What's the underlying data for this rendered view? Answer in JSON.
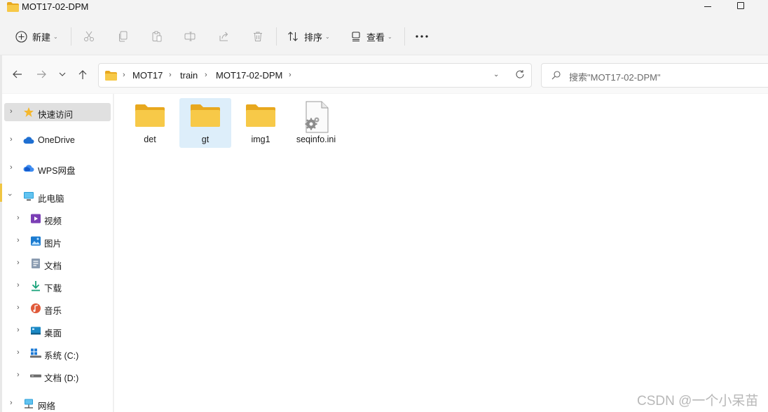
{
  "window": {
    "title": "MOT17-02-DPM"
  },
  "toolbar": {
    "new_label": "新建",
    "cut_label": "",
    "sort_label": "排序",
    "view_label": "查看",
    "more_label": "···"
  },
  "address": {
    "crumbs": [
      "MOT17",
      "train",
      "MOT17-02-DPM"
    ],
    "search_placeholder": "搜索\"MOT17-02-DPM\""
  },
  "sidebar": {
    "items": [
      {
        "label": "快速访问",
        "icon": "star-icon",
        "selected": true
      },
      {
        "label": "OneDrive",
        "icon": "cloud-icon"
      },
      {
        "label": "WPS网盘",
        "icon": "wps-cloud-icon"
      },
      {
        "label": "此电脑",
        "icon": "computer-icon",
        "expanded": true
      },
      {
        "label": "视频",
        "icon": "video-icon"
      },
      {
        "label": "图片",
        "icon": "pictures-icon"
      },
      {
        "label": "文档",
        "icon": "documents-icon"
      },
      {
        "label": "下载",
        "icon": "download-icon"
      },
      {
        "label": "音乐",
        "icon": "music-icon"
      },
      {
        "label": "桌面",
        "icon": "desktop-icon"
      },
      {
        "label": "系统 (C:)",
        "icon": "drive-c-icon"
      },
      {
        "label": "文档 (D:)",
        "icon": "drive-d-icon"
      },
      {
        "label": "网络",
        "icon": "network-icon"
      }
    ]
  },
  "files": [
    {
      "name": "det",
      "type": "folder"
    },
    {
      "name": "gt",
      "type": "folder",
      "selected": true
    },
    {
      "name": "img1",
      "type": "folder"
    },
    {
      "name": "seqinfo.ini",
      "type": "settings-file"
    }
  ],
  "watermark": "CSDN @一个小呆苗",
  "colors": {
    "folder": "#f7c948",
    "folder_dark": "#e8a81e",
    "selection": "#ddeefa",
    "accent": "#0067c0"
  }
}
